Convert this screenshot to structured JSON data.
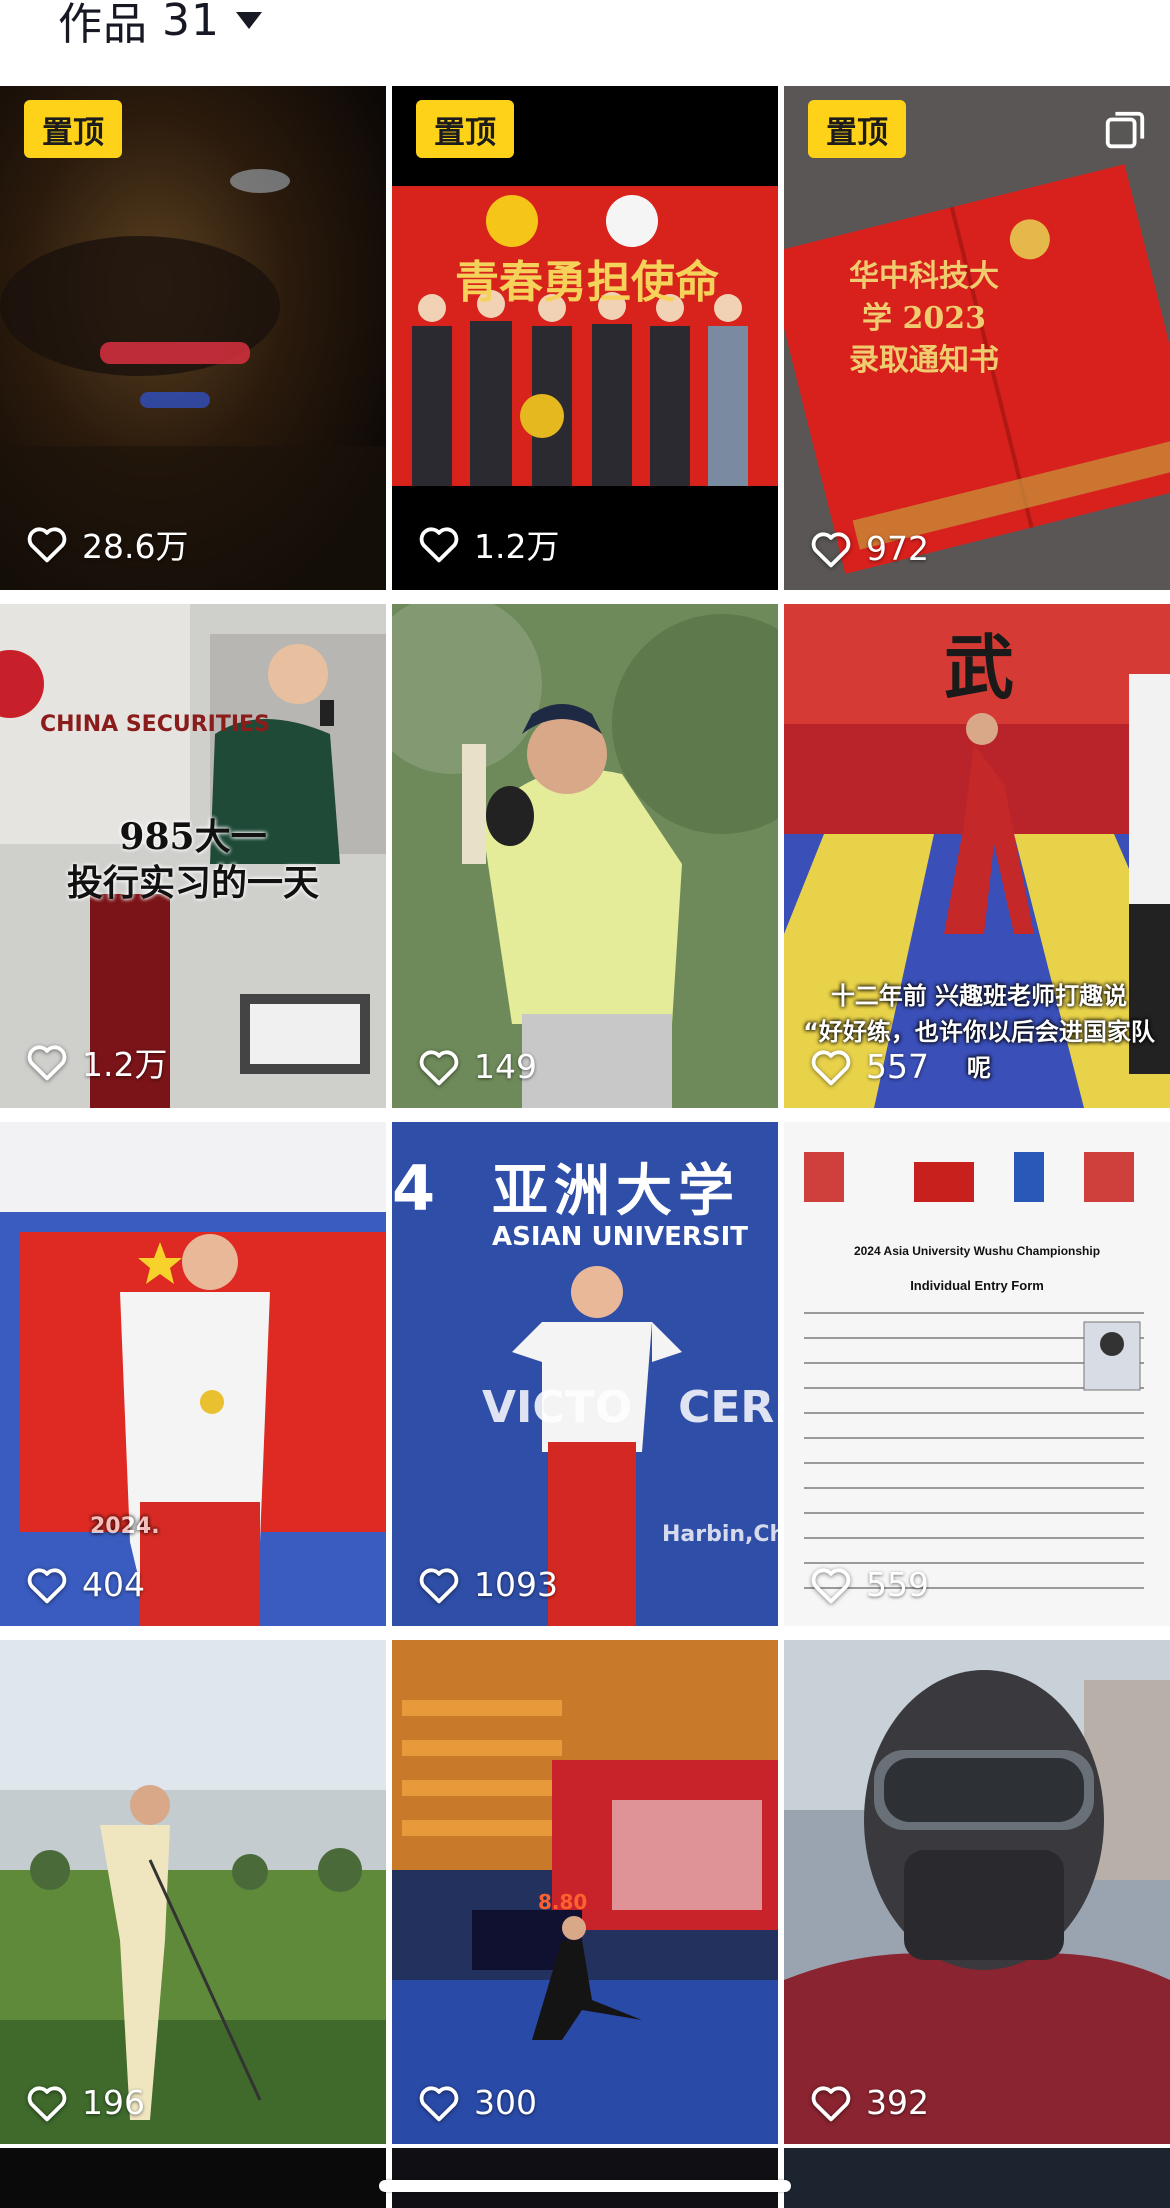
{
  "header": {
    "label": "作品",
    "count": "31"
  },
  "pin_label": "置顶",
  "tiles": [
    {
      "likes": "28.6万"
    },
    {
      "likes": "1.2万",
      "banner": "青春勇担使命"
    },
    {
      "likes": "972",
      "cover": "华中科技大学 2023 录取通知书"
    },
    {
      "likes": "1.2万",
      "caption_line1": "985大一",
      "caption_line2": "投行实习的一天",
      "sign": "CHINA SECURITIES"
    },
    {
      "likes": "149"
    },
    {
      "likes": "557",
      "caption_line1": "十二年前 兴趣班老师打趣说",
      "caption_line2": "“好好练，也许你以后会进国家队呢",
      "banner": "武"
    },
    {
      "likes": "404",
      "backdrop": "2024."
    },
    {
      "likes": "1093",
      "backdrop_cn": "亚洲大学",
      "backdrop_en": "ASIAN UNIVERSIT",
      "backdrop_victory": "VICTO   CERE",
      "backdrop_city": "Harbin,China",
      "backdrop_num": "4"
    },
    {
      "likes": "559",
      "doc_title": "2024 Asia University Wushu Championship",
      "doc_subtitle": "Individual Entry Form"
    },
    {
      "likes": "196"
    },
    {
      "likes": "300",
      "scoreboard": "8.80"
    },
    {
      "likes": "392"
    }
  ]
}
